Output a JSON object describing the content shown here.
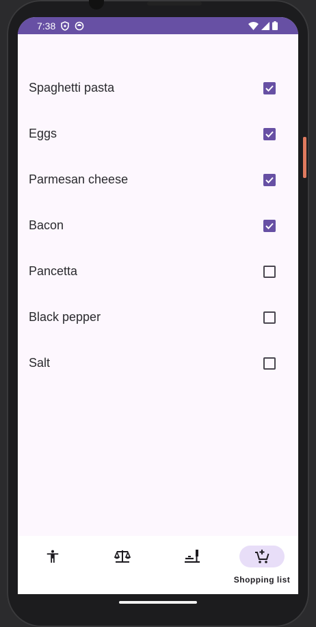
{
  "status_bar": {
    "time": "7:38",
    "icons_left": [
      "shield-icon",
      "sync-icon"
    ],
    "icons_right": [
      "wifi-icon",
      "signal-icon",
      "battery-icon"
    ],
    "background_color": "#6750a4"
  },
  "shopping_list": {
    "items": [
      {
        "label": "Spaghetti pasta",
        "checked": true
      },
      {
        "label": "Eggs",
        "checked": true
      },
      {
        "label": "Parmesan cheese",
        "checked": true
      },
      {
        "label": "Bacon",
        "checked": true
      },
      {
        "label": "Pancetta",
        "checked": false
      },
      {
        "label": "Black pepper",
        "checked": false
      },
      {
        "label": "Salt",
        "checked": false
      }
    ]
  },
  "bottom_nav": {
    "items": [
      {
        "icon": "person-icon",
        "label": "",
        "active": false
      },
      {
        "icon": "scale-icon",
        "label": "",
        "active": false
      },
      {
        "icon": "cooking-icon",
        "label": "",
        "active": false
      },
      {
        "icon": "add-cart-icon",
        "label": "Shopping list",
        "active": true
      }
    ]
  },
  "colors": {
    "accent": "#6750a4",
    "active_indicator": "#e8def8",
    "screen_background": "#fdf7fe"
  }
}
